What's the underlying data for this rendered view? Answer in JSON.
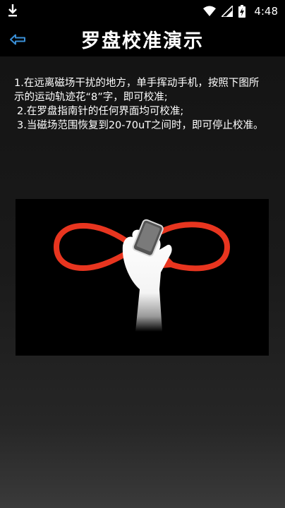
{
  "status_bar": {
    "time": "4:48",
    "icons": [
      "download-icon",
      "wifi-icon",
      "signal-icon",
      "battery-icon"
    ]
  },
  "header": {
    "title": "罗盘校准演示",
    "back_icon": "back-arrow-icon"
  },
  "instructions": [
    "1.在远离磁场干扰的地方，单手挥动手机，按照下图所示的运动轨迹花“8”字，即可校准;",
    "2.在罗盘指南针的任何界面均可校准;",
    "3.当磁场范围恢复到20-70uT之间时，即可停止校准。"
  ],
  "colors": {
    "accent_red": "#e8351f",
    "back_arrow": "#3a8fd6",
    "header_bg": "#000000"
  }
}
